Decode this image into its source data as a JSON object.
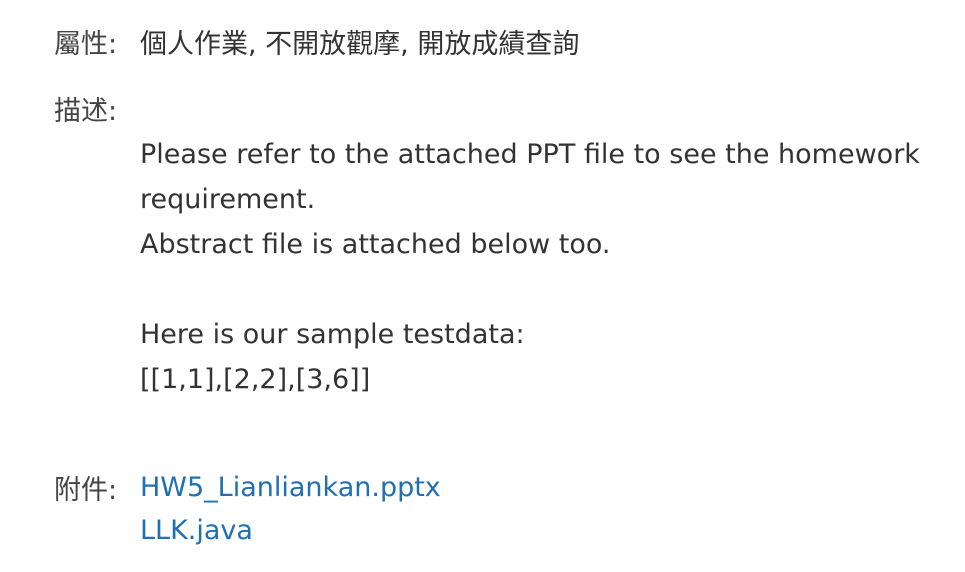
{
  "attributes": {
    "label": "屬性:",
    "value": "個人作業, 不開放觀摩, 開放成績查詢"
  },
  "description": {
    "label": "描述:",
    "lines": [
      "Please refer to the attached PPT file to see the homework",
      "requirement.",
      "Abstract file is attached below too.",
      "",
      "Here is our sample testdata:",
      "[[1,1],[2,2],[3,6]]"
    ]
  },
  "attachments": {
    "label": "附件:",
    "files": [
      "HW5_Lianliankan.pptx",
      "LLK.java"
    ]
  },
  "colors": {
    "text": "#333333",
    "label": "#444444",
    "link": "#1f6fb3"
  }
}
